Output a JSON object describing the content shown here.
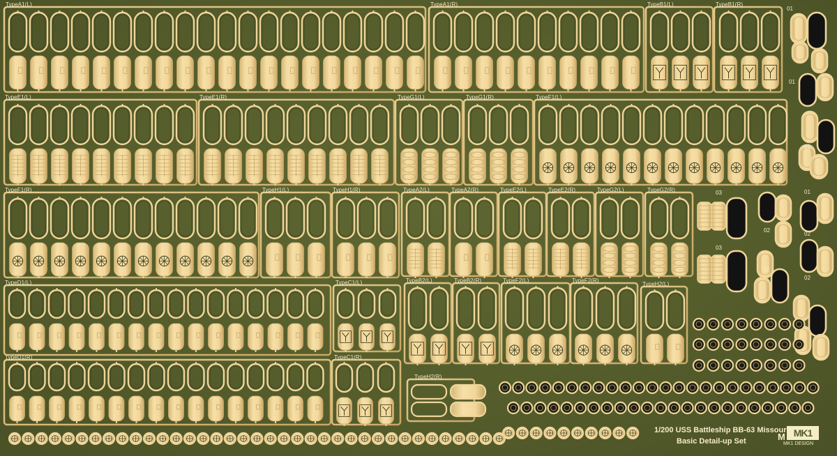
{
  "sheet": {
    "labels": [
      {
        "id": "typeA1L",
        "text": "TypeA1(L)"
      },
      {
        "id": "typeA1R",
        "text": "TypeA1(R)"
      },
      {
        "id": "typeB1L",
        "text": "TypeB1(L)"
      },
      {
        "id": "typeB1R",
        "text": "TypeB1(R)"
      },
      {
        "id": "typeE1L",
        "text": "TypeE1(L)"
      },
      {
        "id": "typeE1R",
        "text": "TypeE1(R)"
      },
      {
        "id": "typeG1L",
        "text": "TypeG1(L)"
      },
      {
        "id": "typeG1R",
        "text": "TypeG1(R)"
      },
      {
        "id": "typeF1L",
        "text": "TypeF1(L)"
      },
      {
        "id": "typeF1R",
        "text": "TypeF1(R)"
      },
      {
        "id": "typeH1L",
        "text": "TypeH1(L)"
      },
      {
        "id": "typeH1R",
        "text": "TypeH1(R)"
      },
      {
        "id": "typeA2L",
        "text": "TypeA2(L)"
      },
      {
        "id": "typeA2R",
        "text": "TypeA2(R)"
      },
      {
        "id": "typeE2L",
        "text": "TypeE2(L)"
      },
      {
        "id": "typeE2R",
        "text": "TypeE2(R)"
      },
      {
        "id": "typeG2L",
        "text": "TypeG2(L)"
      },
      {
        "id": "typeG2R",
        "text": "TypeG2(R)"
      },
      {
        "id": "typeD1L",
        "text": "TypeD1(L)"
      },
      {
        "id": "typeC1L",
        "text": "TypeC1(L)"
      },
      {
        "id": "typeB2L",
        "text": "TypeB2(L)"
      },
      {
        "id": "typeB2R",
        "text": "TypeB2(R)"
      },
      {
        "id": "typeF2L",
        "text": "TypeF2(L)"
      },
      {
        "id": "typeF2R",
        "text": "TypeF2(R)"
      },
      {
        "id": "typeH2L",
        "text": "TypeH2(L)"
      },
      {
        "id": "typeD1R",
        "text": "TypeD1(R)"
      },
      {
        "id": "typeC1R",
        "text": "TypeC1(R)"
      },
      {
        "id": "typeH2R",
        "text": "TypeH2(R)"
      },
      {
        "id": "n01a",
        "text": "01"
      },
      {
        "id": "n01b",
        "text": "01"
      },
      {
        "id": "n01c",
        "text": "01"
      },
      {
        "id": "n01d",
        "text": "01"
      },
      {
        "id": "n02a",
        "text": "02"
      },
      {
        "id": "n02b",
        "text": "02"
      },
      {
        "id": "n02c",
        "text": "02"
      },
      {
        "id": "n02d",
        "text": "02"
      },
      {
        "id": "n03a",
        "text": "03"
      },
      {
        "id": "n03b",
        "text": "03"
      }
    ],
    "title_line1": "1/200 USS Battleship BB-63 Missouri",
    "title_line2": "Basic Detail-up Set",
    "maker_letter": "M",
    "logo_text": "MK1",
    "brand": "MK1 DESIGN",
    "colors": {
      "fret": "#555d2c",
      "brass": "#f0d59a",
      "brass_shade": "#c9ab6a",
      "etch_line": "#2f3418",
      "dark_recess": "#121212"
    }
  }
}
